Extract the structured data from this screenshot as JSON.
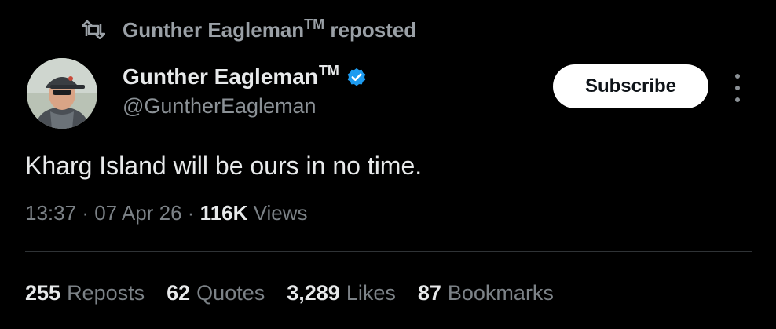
{
  "repost": {
    "icon": "repost-icon",
    "name": "Gunther Eagleman",
    "tm": "TM",
    "suffix": "reposted"
  },
  "author": {
    "name": "Gunther Eagleman",
    "tm": "TM",
    "handle": "@GuntherEagleman",
    "verified": true,
    "verified_color": "#1d9bf0"
  },
  "actions": {
    "subscribe_label": "Subscribe",
    "more_icon": "more-vertical-icon"
  },
  "tweet": {
    "text": "Kharg Island will be ours in no time."
  },
  "meta": {
    "time": "13:37",
    "date": "07 Apr 26",
    "views_count": "116K",
    "views_label": "Views",
    "separator": "·"
  },
  "stats": [
    {
      "count": "255",
      "label": "Reposts"
    },
    {
      "count": "62",
      "label": "Quotes"
    },
    {
      "count": "3,289",
      "label": "Likes"
    },
    {
      "count": "87",
      "label": "Bookmarks"
    }
  ],
  "colors": {
    "background": "#000000",
    "primary_text": "#e7e9ea",
    "secondary_text": "#7c8287",
    "divider": "#2f3336"
  }
}
